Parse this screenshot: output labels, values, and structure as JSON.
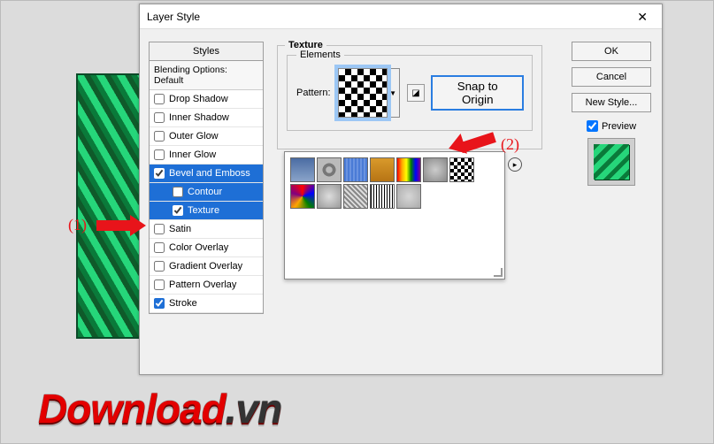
{
  "dialog": {
    "title": "Layer Style",
    "close": "✕"
  },
  "sidebar": {
    "header": "Styles",
    "blending": "Blending Options: Default",
    "items": [
      {
        "label": "Drop Shadow",
        "checked": false,
        "selected": false,
        "sub": false
      },
      {
        "label": "Inner Shadow",
        "checked": false,
        "selected": false,
        "sub": false
      },
      {
        "label": "Outer Glow",
        "checked": false,
        "selected": false,
        "sub": false
      },
      {
        "label": "Inner Glow",
        "checked": false,
        "selected": false,
        "sub": false
      },
      {
        "label": "Bevel and Emboss",
        "checked": true,
        "selected": true,
        "sub": false
      },
      {
        "label": "Contour",
        "checked": false,
        "selected": true,
        "sub": true
      },
      {
        "label": "Texture",
        "checked": true,
        "selected": true,
        "sub": true
      },
      {
        "label": "Satin",
        "checked": false,
        "selected": false,
        "sub": false
      },
      {
        "label": "Color Overlay",
        "checked": false,
        "selected": false,
        "sub": false
      },
      {
        "label": "Gradient Overlay",
        "checked": false,
        "selected": false,
        "sub": false
      },
      {
        "label": "Pattern Overlay",
        "checked": false,
        "selected": false,
        "sub": false
      },
      {
        "label": "Stroke",
        "checked": true,
        "selected": false,
        "sub": false
      }
    ]
  },
  "texture": {
    "section_title": "Texture",
    "elements_title": "Elements",
    "pattern_label": "Pattern:",
    "dropdown_glyph": "▼",
    "new_preset_icon": "◪",
    "snap_button": "Snap to Origin"
  },
  "popup": {
    "menu_glyph": "▸",
    "item_count": 12
  },
  "buttons": {
    "ok": "OK",
    "cancel": "Cancel",
    "new_style": "New Style...",
    "preview": "Preview",
    "preview_checked": true
  },
  "annotations": {
    "one": "(1)",
    "two": "(2)"
  },
  "watermark": {
    "main": "Download",
    "suffix": ".vn"
  }
}
